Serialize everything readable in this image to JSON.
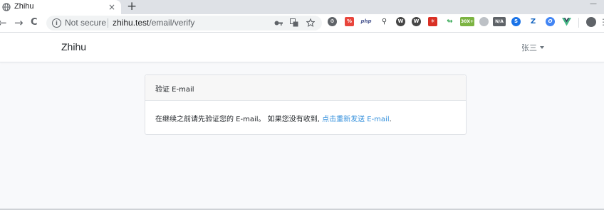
{
  "browser": {
    "tab_title": "Zhihu",
    "tab_close": "×",
    "new_tab": "+",
    "window_controls": "—",
    "back": "←",
    "forward": "→",
    "reload": "C",
    "security_label": "Not secure",
    "url_host": "zhihu.test",
    "url_path": "/email/verify",
    "menu": "⋮",
    "extensions": [
      {
        "name": "gear-extension",
        "label": "⚙",
        "color": "#5f6368"
      },
      {
        "name": "red-extension",
        "label": "%",
        "color": "#e8453c"
      },
      {
        "name": "php-extension",
        "label": "php",
        "color": "#4f5b93"
      },
      {
        "name": "figure-extension",
        "label": "✱",
        "color": "#3c4043"
      },
      {
        "name": "wordpress-extension",
        "label": "W",
        "color": "#464646"
      },
      {
        "name": "wordpress2-extension",
        "label": "W",
        "color": "#464646"
      },
      {
        "name": "bug-extension",
        "label": "✳",
        "color": "#d93025"
      },
      {
        "name": "leaf-extension",
        "label": "~",
        "color": "#34a853"
      },
      {
        "name": "counter-extension",
        "label": "30X+",
        "color": "#7cb342"
      },
      {
        "name": "circle-extension",
        "label": "◐",
        "color": "#9aa0a6"
      },
      {
        "name": "na-extension",
        "label": "N/A",
        "color": "#5f6368"
      },
      {
        "name": "s-extension",
        "label": "S",
        "color": "#1a73e8"
      },
      {
        "name": "z-extension",
        "label": "Z",
        "color": "#1565c0"
      },
      {
        "name": "o-extension",
        "label": "O",
        "color": "#4285f4"
      },
      {
        "name": "vue-extension",
        "label": "V",
        "color": "#41b883"
      }
    ]
  },
  "page": {
    "brand": "Zhihu",
    "user_name": "张三",
    "card_title": "验证 E-mail",
    "body_text": "在继续之前请先验证您的 E-mail。 如果您没有收到, ",
    "resend_link": "点击重新发送 E-mail",
    "body_end": "."
  }
}
